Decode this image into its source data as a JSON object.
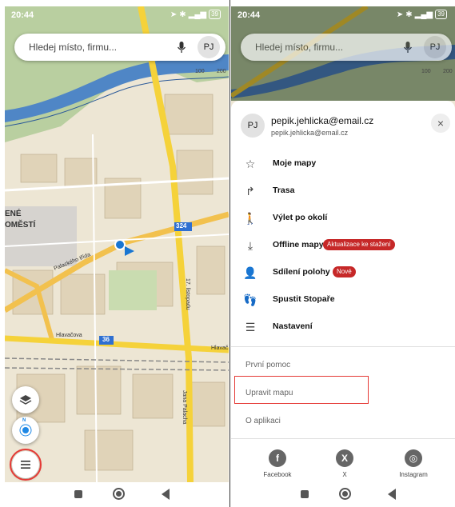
{
  "status": {
    "time": "20:44",
    "battery": "39"
  },
  "search": {
    "placeholder": "Hledej místo, firmu...",
    "avatar": "PJ"
  },
  "map": {
    "labels": {
      "ene": "ENÉ",
      "omesti": "OMĚSTÍ",
      "street1": "Palackého třída",
      "street2": "Hlavačova",
      "street3": "Hlavač",
      "street4": "Jana Palacha",
      "road_num1": "324",
      "road_num2": "36",
      "road_17": "17. listopadu"
    },
    "scale": [
      "100",
      "200"
    ]
  },
  "account": {
    "avatar": "PJ",
    "name": "pepik.jehlicka@email.cz",
    "email": "pepik.jehlicka@email.cz",
    "close": "×"
  },
  "menu": [
    {
      "label": "Moje mapy",
      "icon": "star-icon"
    },
    {
      "label": "Trasa",
      "icon": "route-icon"
    },
    {
      "label": "Výlet po okolí",
      "icon": "hiking-icon"
    },
    {
      "label": "Offline mapy",
      "icon": "download-icon",
      "badge": "Aktualizace ke stažení"
    },
    {
      "label": "Sdílení polohy",
      "icon": "share-location-icon",
      "badge": "Nové"
    },
    {
      "label": "Spustit Stopaře",
      "icon": "footprints-icon"
    },
    {
      "label": "Nastavení",
      "icon": "settings-sliders-icon"
    }
  ],
  "secondary": [
    "První pomoc",
    "Upravit mapu",
    "O aplikaci"
  ],
  "social": [
    {
      "label": "Facebook",
      "glyph": "f"
    },
    {
      "label": "X",
      "glyph": "X"
    },
    {
      "label": "Instagram",
      "glyph": "◎"
    }
  ],
  "compass": "N",
  "colors": {
    "badge": "#c62828",
    "highlight": "#e53935",
    "road": "#f5d23a",
    "river": "#4f86c6"
  }
}
